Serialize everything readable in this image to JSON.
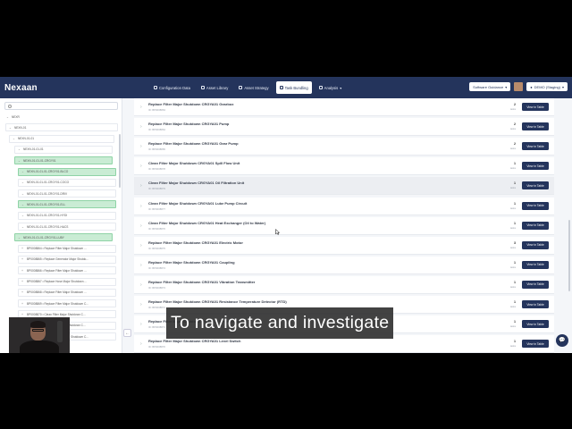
{
  "header": {
    "logo": "Nexaan",
    "nav": [
      {
        "label": "Configuration Data",
        "icon": "database-icon",
        "active": false
      },
      {
        "label": "Asset Library",
        "icon": "library-icon",
        "active": false
      },
      {
        "label": "Asset Strategy",
        "icon": "strategy-icon",
        "active": false
      },
      {
        "label": "Task Bundling",
        "icon": "bundle-icon",
        "active": true
      },
      {
        "label": "Analysis",
        "icon": "analysis-icon",
        "active": false
      }
    ],
    "software_guidance": "Software Guidance",
    "env": "DEMO (Staging)"
  },
  "sidebar": {
    "tree": [
      {
        "label": "NEXR",
        "hl": false,
        "plain": true
      },
      {
        "label": "NEXN-01",
        "hl": false
      },
      {
        "label": "NEXN-01-01",
        "hl": false
      },
      {
        "label": "NEXN-01-01-01",
        "hl": false
      },
      {
        "label": "NEXN-01-01-01-CRGY01",
        "hl": true
      },
      {
        "label": "NEXN-01-01-01-CRGY01-BLCO",
        "hl": true
      },
      {
        "label": "NEXN-01-01-01-CRGY01-COCO",
        "hl": false
      },
      {
        "label": "NEXN-01-01-01-CRGY01-DRIV",
        "hl": false
      },
      {
        "label": "NEXN-01-01-01-CRGY01-ELL",
        "hl": true
      },
      {
        "label": "NEXN-01-01-01-CRGY01-HYDI",
        "hl": false
      },
      {
        "label": "NEXN-01-01-01-CRGY01-HACS",
        "hl": false
      },
      {
        "label": "NEXN-01-01-01-CRGY01-LUBY",
        "hl": true
      },
      {
        "label": "BP0008864 • Replace Filter Major Shutdown ...",
        "hl": false
      },
      {
        "label": "BP0008865 • Replace Generator Major Shutdo...",
        "hl": false
      },
      {
        "label": "BP0008866 • Replace Filter Major Shutdown ...",
        "hl": false
      },
      {
        "label": "BP0008867 • Replace Hose Major Shutdown ...",
        "hl": false
      },
      {
        "label": "BP0008868 • Replace Filter Major Shutdown ...",
        "hl": false
      },
      {
        "label": "BP0008869 • Replace Filter Major Shutdown C...",
        "hl": false
      },
      {
        "label": "BP0008870 • Clean Filter Major Shutdown C...",
        "hl": false
      },
      {
        "label": "BP0008871 • Clean Filter Major Shutdown C...",
        "hl": false
      },
      {
        "label": "BP0008872 • Replace Filter Major Shutdown C...",
        "hl": false
      }
    ]
  },
  "tasks": [
    {
      "title": "Replace Filter Major Shutdown CRGYA01 Gearbox",
      "id": "ID: BP0008863",
      "count": "2",
      "count_label": "tasks",
      "btn": "View in Table"
    },
    {
      "title": "Replace Filter Major Shutdown CRGYA01 Pump",
      "id": "ID: BP0008864",
      "count": "2",
      "count_label": "tasks",
      "btn": "View in Table"
    },
    {
      "title": "Replace Filter Major Shutdown CRGYA01 Gear Pump",
      "id": "ID: BP0008865",
      "count": "2",
      "count_label": "tasks",
      "btn": "View in Table"
    },
    {
      "title": "Clean Filter Major Shutdown CRGYA01 Spill Flow Unit",
      "id": "ID: BP0008878",
      "count": "1",
      "count_label": "tasks",
      "btn": "View in Table"
    },
    {
      "title": "Clean Filter Major Shutdown CRGYA01 Oil Filtration Unit",
      "id": "ID: BP0008879",
      "count": "1",
      "count_label": "tasks",
      "btn": "View in Table",
      "selected": true
    },
    {
      "title": "Clean Filter Major Shutdown CRGYA01 Lube Pump Circuit",
      "id": "ID: BP0008877",
      "count": "1",
      "count_label": "tasks",
      "btn": "View in Table"
    },
    {
      "title": "Clean Filter Major Shutdown CRGYA01 Heat Exchanger (Oil to Water)",
      "id": "ID: BP0008876",
      "count": "1",
      "count_label": "tasks",
      "btn": "View in Table"
    },
    {
      "title": "Replace Filter Major Shutdown CRGYA01 Electric Motor",
      "id": "ID: BP0008875",
      "count": "3",
      "count_label": "tasks",
      "btn": "View in Table"
    },
    {
      "title": "Replace Filter Major Shutdown CRGYA01 Coupling",
      "id": "ID: BP0008874",
      "count": "1",
      "count_label": "tasks",
      "btn": "View in Table"
    },
    {
      "title": "Replace Filter Major Shutdown CRGYA01 Vibration Transmitter",
      "id": "ID: BP0008873",
      "count": "1",
      "count_label": "tasks",
      "btn": "View in Table"
    },
    {
      "title": "Replace Filter Major Shutdown CRGYA01 Resistance Temperature Detector (RTD)",
      "id": "ID: BP0008872",
      "count": "1",
      "count_label": "tasks",
      "btn": "View in Table"
    },
    {
      "title": "Replace Filter Major Shutdown CRGYA01 Pressure Switch",
      "id": "ID: BP0008871",
      "count": "1",
      "count_label": "tasks",
      "btn": "View in Table"
    },
    {
      "title": "Replace Filter Major Shutdown CRGYA01 Level Switch",
      "id": "ID: BP0008870",
      "count": "1",
      "count_label": "tasks",
      "btn": "View in Table"
    }
  ],
  "caption": "To navigate and investigate",
  "colors": {
    "navy": "#24345c",
    "highlight": "#c9ecd4",
    "accent": "#4fb0ff"
  }
}
